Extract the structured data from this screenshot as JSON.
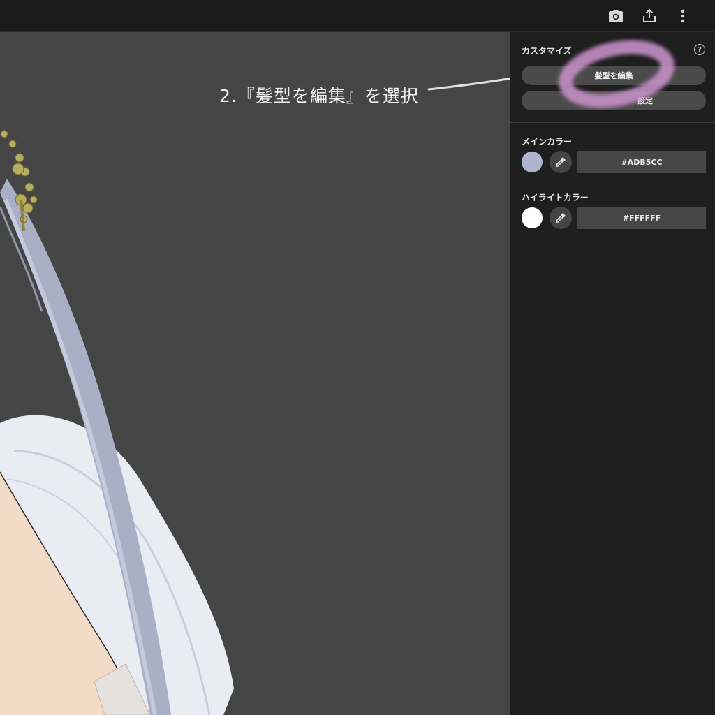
{
  "toolbar": {
    "camera_icon": "camera-icon",
    "share_icon": "share-icon",
    "more_icon": "more-vertical-icon"
  },
  "viewport": {
    "annotation": "2.『髪型を編集』を選択"
  },
  "panel": {
    "customize_title": "カスタマイズ",
    "help_label": "?",
    "edit_hair_label": "髪型を編集",
    "second_button_label": "設定",
    "main_color_title": "メインカラー",
    "main_color_hex": "#ADB5CC",
    "main_color_value": "#ADB5CC",
    "highlight_color_title": "ハイライトカラー",
    "highlight_color_hex": "#FFFFFF",
    "highlight_color_value": "#FFFFFF",
    "highlight_ring_color": "#c58fc6"
  }
}
